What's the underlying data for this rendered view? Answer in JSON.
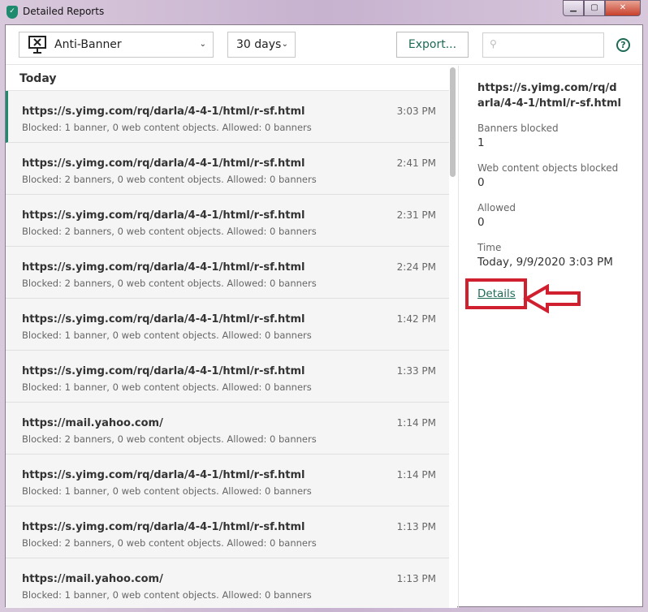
{
  "window": {
    "title": "Detailed Reports"
  },
  "toolbar": {
    "component": "Anti-Banner",
    "period": "30 days",
    "export_label": "Export...",
    "search_placeholder": "",
    "help": "?"
  },
  "list": {
    "section": "Today",
    "rows": [
      {
        "url": "https://s.yimg.com/rq/darla/4-4-1/html/r-sf.html",
        "desc": "Blocked: 1 banner, 0 web content objects. Allowed: 0 banners",
        "time": "3:03 PM"
      },
      {
        "url": "https://s.yimg.com/rq/darla/4-4-1/html/r-sf.html",
        "desc": "Blocked: 2 banners, 0 web content objects. Allowed: 0 banners",
        "time": "2:41 PM"
      },
      {
        "url": "https://s.yimg.com/rq/darla/4-4-1/html/r-sf.html",
        "desc": "Blocked: 2 banners, 0 web content objects. Allowed: 0 banners",
        "time": "2:31 PM"
      },
      {
        "url": "https://s.yimg.com/rq/darla/4-4-1/html/r-sf.html",
        "desc": "Blocked: 2 banners, 0 web content objects. Allowed: 0 banners",
        "time": "2:24 PM"
      },
      {
        "url": "https://s.yimg.com/rq/darla/4-4-1/html/r-sf.html",
        "desc": "Blocked: 1 banner, 0 web content objects. Allowed: 0 banners",
        "time": "1:42 PM"
      },
      {
        "url": "https://s.yimg.com/rq/darla/4-4-1/html/r-sf.html",
        "desc": "Blocked: 1 banner, 0 web content objects. Allowed: 0 banners",
        "time": "1:33 PM"
      },
      {
        "url": "https://mail.yahoo.com/",
        "desc": "Blocked: 2 banners, 0 web content objects. Allowed: 0 banners",
        "time": "1:14 PM"
      },
      {
        "url": "https://s.yimg.com/rq/darla/4-4-1/html/r-sf.html",
        "desc": "Blocked: 1 banner, 0 web content objects. Allowed: 0 banners",
        "time": "1:14 PM"
      },
      {
        "url": "https://s.yimg.com/rq/darla/4-4-1/html/r-sf.html",
        "desc": "Blocked: 2 banners, 0 web content objects. Allowed: 0 banners",
        "time": "1:13 PM"
      },
      {
        "url": "https://mail.yahoo.com/",
        "desc": "Blocked: 1 banner, 0 web content objects. Allowed: 0 banners",
        "time": "1:13 PM"
      }
    ]
  },
  "detail": {
    "title": "https://s.yimg.com/rq/darla/4-4-1/html/r-sf.html",
    "banners_label": "Banners blocked",
    "banners": "1",
    "web_label": "Web content objects blocked",
    "web": "0",
    "allowed_label": "Allowed",
    "allowed": "0",
    "time_label": "Time",
    "time": "Today, 9/9/2020 3:03 PM",
    "details_link": "Details"
  }
}
